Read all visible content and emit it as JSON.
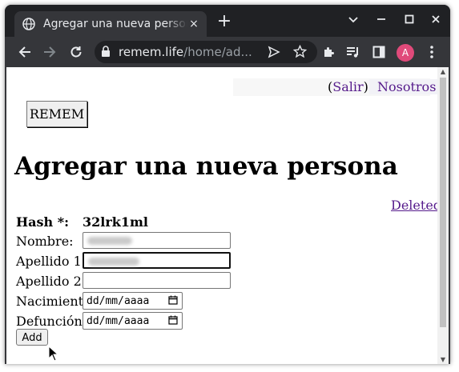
{
  "browser": {
    "tab_title": "Agregar una nueva persona",
    "tab_close": "×",
    "new_tab": "+",
    "url_host": "remem.life",
    "url_path": "/home/ad...",
    "profile_initial": "A",
    "profile_color": "#e04a7a"
  },
  "nav": {
    "salir_open": "(",
    "salir": "Salir",
    "salir_close": ")",
    "nosotros": "Nosotros"
  },
  "brand": "REMEM",
  "page_title": "Agregar una nueva persona",
  "deleted_link": "Deleted",
  "form": {
    "hash_label": "Hash *:",
    "hash_value": "32lrk1ml",
    "nombre_label": "Nombre:",
    "apellido1_label": "Apellido 1:",
    "apellido2_label": "Apellido 2:",
    "nacimiento_label": "Nacimiento:",
    "nacimiento_value": "dd/mm/aaaa",
    "defuncion_label": "Defunción:",
    "defuncion_value": "dd/mm/aaaa",
    "submit_label": "Add"
  }
}
